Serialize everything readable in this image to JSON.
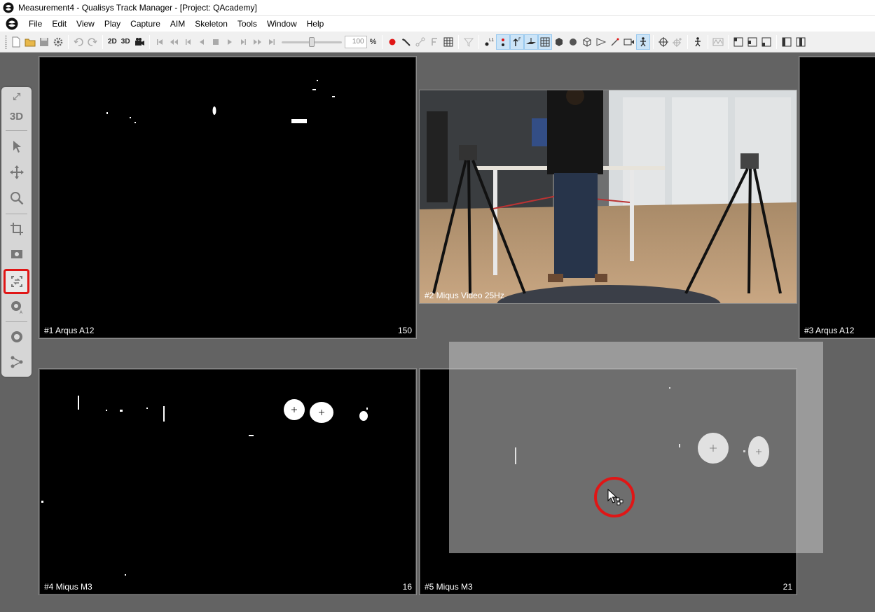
{
  "window": {
    "title": "Measurement4 - Qualisys Track Manager - [Project: QAcademy]"
  },
  "menu": {
    "items": [
      "File",
      "Edit",
      "View",
      "Play",
      "Capture",
      "AIM",
      "Skeleton",
      "Tools",
      "Window",
      "Help"
    ]
  },
  "toolbar": {
    "view_2d": "2D",
    "view_3d": "3D",
    "speed_value": "100",
    "speed_unit": "%",
    "speed_level_percent": 50
  },
  "palette": {
    "view_3d_label": "3D"
  },
  "views": [
    {
      "label": "#1 Arqus A12",
      "count": "150"
    },
    {
      "label": "#2 Miqus Video 25Hz",
      "count": ""
    },
    {
      "label": "#3 Arqus A12",
      "count": ""
    },
    {
      "label": "#4 Miqus M3",
      "count": "16"
    },
    {
      "label": "#5 Miqus M3",
      "count": "21"
    }
  ],
  "colors": {
    "highlight": "#e01616",
    "record": "#e01616",
    "background": "#636363"
  }
}
